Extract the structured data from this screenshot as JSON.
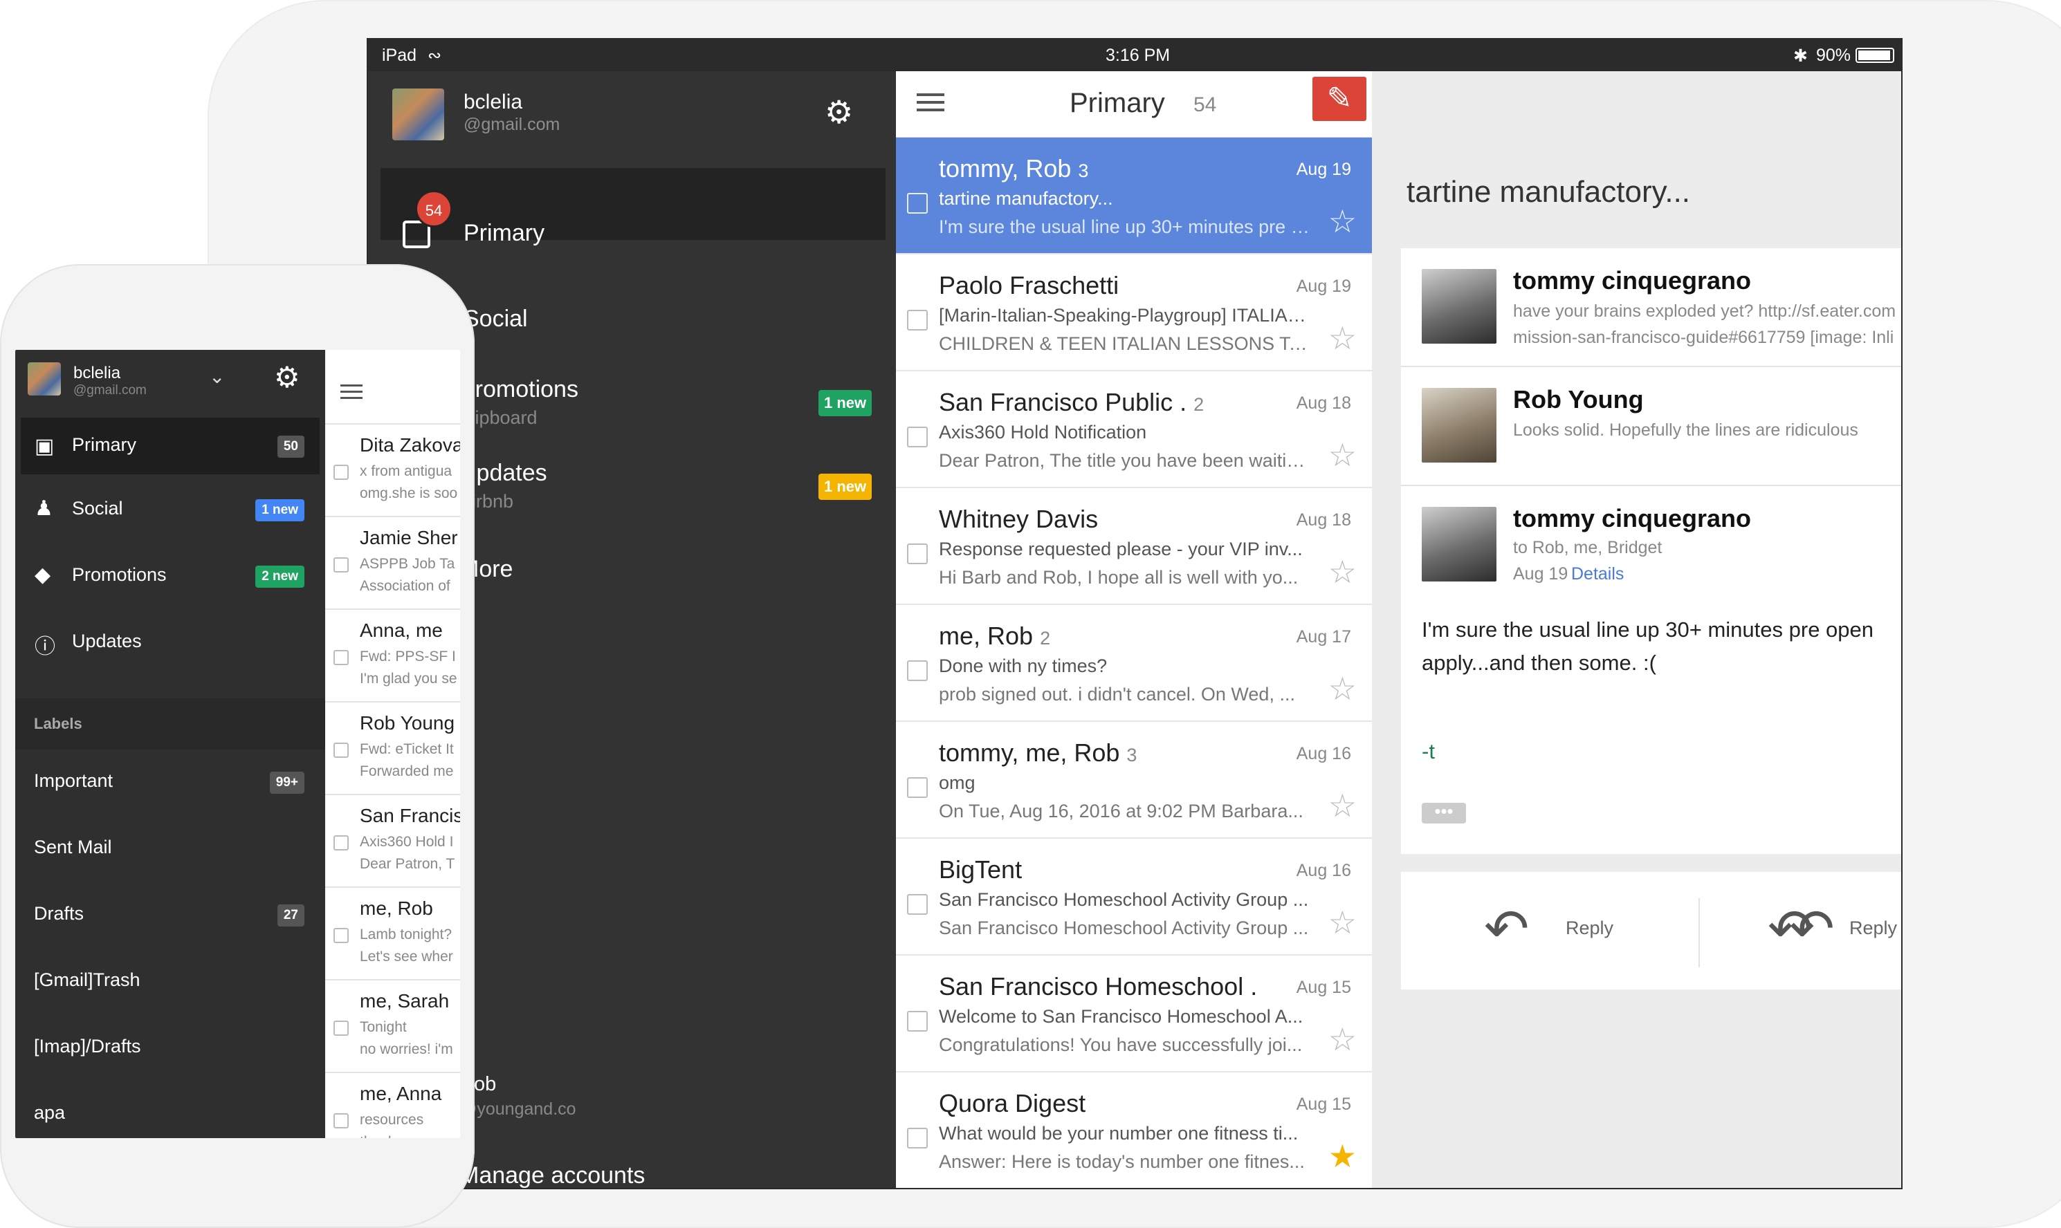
{
  "colors": {
    "accent_red": "#db4437",
    "selected_blue": "#5b86dc",
    "badge_green": "#1ea362",
    "badge_yellow": "#f4b400",
    "drawer_bg": "#333333",
    "star_gold": "#f4b400"
  },
  "ipad": {
    "status": {
      "device": "iPad",
      "time": "3:16 PM",
      "battery": "90%"
    },
    "account": {
      "name": "bclelia",
      "email": "@gmail.com"
    },
    "drawer": {
      "primary": {
        "label": "Primary",
        "badge": "54"
      },
      "social": {
        "label": "Social"
      },
      "promotions": {
        "label": "Promotions",
        "sub": "Flipboard",
        "badge": "1 new"
      },
      "updates": {
        "label": "Updates",
        "sub": "Airbnb",
        "badge": "1 new"
      },
      "more": {
        "label": "More"
      },
      "other_account": {
        "name": "Rob",
        "email": "@youngand.co"
      },
      "manage": "Manage accounts"
    },
    "list": {
      "title": "Primary",
      "count": "54",
      "rows": [
        {
          "from": "tommy, Rob",
          "count": "3",
          "date": "Aug 19",
          "subject": "tartine manufactory...",
          "snippet": "I'm sure the usual line up 30+ minutes pre open apply...",
          "starred": false,
          "selected": true
        },
        {
          "from": "Paolo Fraschetti",
          "count": "",
          "date": "Aug 19",
          "subject": "[Marin-Italian-Speaking-Playgroup] ITALIAN...",
          "snippet": "CHILDREN & TEEN ITALIAN LESSONS To...",
          "starred": false
        },
        {
          "from": "San Francisco Public .",
          "count": "2",
          "date": "Aug 18",
          "subject": "Axis360 Hold Notification",
          "snippet": "Dear Patron, The title you have been waiting...",
          "starred": false
        },
        {
          "from": "Whitney Davis",
          "count": "",
          "date": "Aug 18",
          "subject": "Response requested please - your VIP inv...",
          "snippet": "Hi Barb and Rob, I hope all is well with yo...",
          "starred": false
        },
        {
          "from": "me, Rob",
          "count": "2",
          "date": "Aug 17",
          "subject": "Done with ny times?",
          "snippet": "prob signed out. i didn't cancel. On Wed, ...",
          "starred": false
        },
        {
          "from": "tommy, me, Rob",
          "count": "3",
          "date": "Aug 16",
          "subject": "omg",
          "snippet": "On Tue, Aug 16, 2016 at 9:02 PM Barbara...",
          "starred": false
        },
        {
          "from": "BigTent",
          "count": "",
          "date": "Aug 16",
          "subject": "San Francisco Homeschool Activity Group ...",
          "snippet": "San Francisco Homeschool Activity Group ...",
          "starred": false
        },
        {
          "from": "San Francisco Homeschool .",
          "count": "",
          "date": "Aug 15",
          "subject": "Welcome to San Francisco Homeschool A...",
          "snippet": "Congratulations! You have successfully joi...",
          "starred": false
        },
        {
          "from": "Quora Digest",
          "count": "",
          "date": "Aug 15",
          "subject": "What would be your number one fitness ti...",
          "snippet": "Answer: Here is today's number one fitnes...",
          "starred": true
        }
      ]
    },
    "detail": {
      "subject": "tartine manufactory...",
      "messages": [
        {
          "name": "tommy cinquegrano",
          "line1": "have your brains exploded yet? http://sf.eater.com",
          "line2": "mission-san-francisco-guide#6617759 [image: Inli"
        },
        {
          "name": "Rob Young",
          "line1": "Looks solid. Hopefully the lines are ridiculous"
        }
      ],
      "expanded": {
        "name": "tommy cinquegrano",
        "to": "to Rob, me, Bridget",
        "date": "Aug 19",
        "details": "Details",
        "body1": "I'm sure the usual line up 30+ minutes pre open",
        "body2": "apply...and then some. :(",
        "sig": "-t"
      },
      "reply": "Reply",
      "reply_all": "Reply"
    }
  },
  "iphone": {
    "account": {
      "name": "bclelia",
      "email": "@gmail.com"
    },
    "items": [
      {
        "label": "Primary",
        "badge": "50"
      },
      {
        "label": "Social",
        "badge": "1 new"
      },
      {
        "label": "Promotions",
        "badge": "2 new"
      },
      {
        "label": "Updates",
        "badge": ""
      }
    ],
    "labels_header": "Labels",
    "labels": [
      {
        "label": "Important",
        "badge": "99+"
      },
      {
        "label": "Sent Mail",
        "badge": ""
      },
      {
        "label": "Drafts",
        "badge": "27"
      },
      {
        "label": "[Gmail]Trash",
        "badge": ""
      },
      {
        "label": "[Imap]/Drafts",
        "badge": ""
      },
      {
        "label": "apa",
        "badge": ""
      }
    ],
    "rows": [
      {
        "from": "Dita Zakova",
        "subject": "x from antigua",
        "snippet": "omg.she is soo"
      },
      {
        "from": "Jamie Sher",
        "subject": "ASPPB Job Ta",
        "snippet": "Association of"
      },
      {
        "from": "Anna, me",
        "subject": "Fwd: PPS-SF I",
        "snippet": "I'm glad you se"
      },
      {
        "from": "Rob Young",
        "subject": "Fwd: eTicket It",
        "snippet": "Forwarded me"
      },
      {
        "from": "San Francis",
        "subject": "Axis360 Hold I",
        "snippet": "Dear Patron, T"
      },
      {
        "from": "me, Rob",
        "subject": "Lamb tonight?",
        "snippet": "Let's see wher"
      },
      {
        "from": "me, Sarah",
        "subject": "Tonight",
        "snippet": "no worries! i'm"
      },
      {
        "from": "me, Anna",
        "subject": "resources",
        "snippet": "thanks so muc"
      }
    ]
  }
}
